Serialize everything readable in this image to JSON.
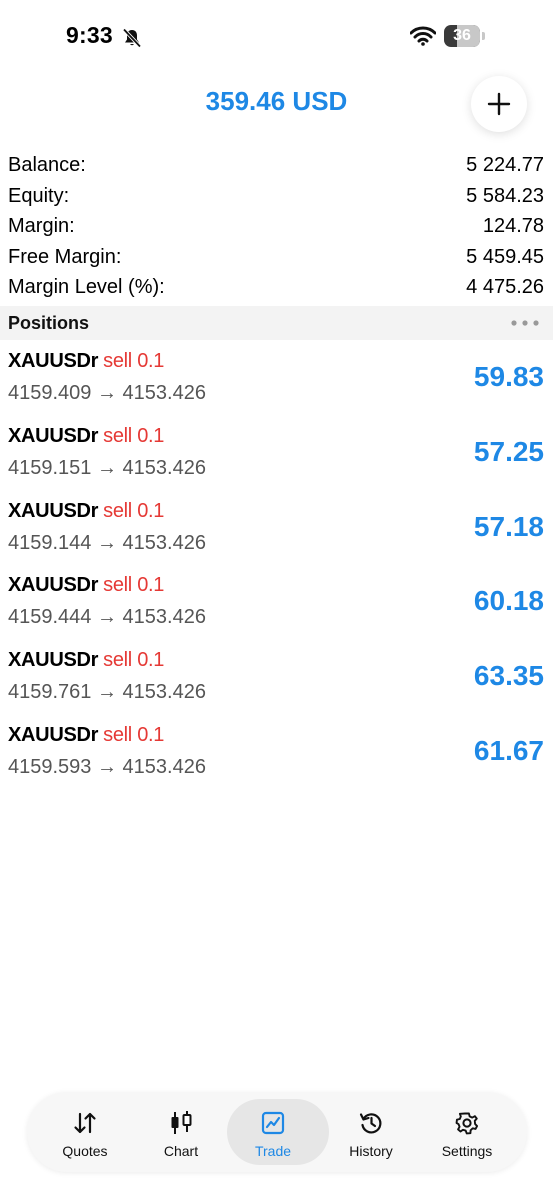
{
  "status_bar": {
    "time": "9:33",
    "battery_level": 36,
    "battery_label": "36"
  },
  "header": {
    "title": "359.46 USD",
    "add_icon": "plus-icon"
  },
  "account": [
    {
      "label": "Balance:",
      "value": "5 224.77"
    },
    {
      "label": "Equity:",
      "value": "5 584.23"
    },
    {
      "label": "Margin:",
      "value": "124.78"
    },
    {
      "label": "Free Margin:",
      "value": "5 459.45"
    },
    {
      "label": "Margin Level (%):",
      "value": "4 475.26"
    }
  ],
  "positions_section": {
    "title": "Positions",
    "menu_icon": "more-icon"
  },
  "positions": [
    {
      "symbol": "XAUUSDr",
      "type": "sell 0.1",
      "prices": "4159.409 → 4153.426",
      "profit": "59.83"
    },
    {
      "symbol": "XAUUSDr",
      "type": "sell 0.1",
      "prices": "4159.151 → 4153.426",
      "profit": "57.25"
    },
    {
      "symbol": "XAUUSDr",
      "type": "sell 0.1",
      "prices": "4159.144 → 4153.426",
      "profit": "57.18"
    },
    {
      "symbol": "XAUUSDr",
      "type": "sell 0.1",
      "prices": "4159.444 → 4153.426",
      "profit": "60.18"
    },
    {
      "symbol": "XAUUSDr",
      "type": "sell 0.1",
      "prices": "4159.761 → 4153.426",
      "profit": "63.35"
    },
    {
      "symbol": "XAUUSDr",
      "type": "sell 0.1",
      "prices": "4159.593 → 4153.426",
      "profit": "61.67"
    }
  ],
  "tabs": [
    {
      "label": "Quotes",
      "icon": "quotes-icon",
      "active": false
    },
    {
      "label": "Chart",
      "icon": "chart-icon",
      "active": false
    },
    {
      "label": "Trade",
      "icon": "trade-icon",
      "active": true
    },
    {
      "label": "History",
      "icon": "history-icon",
      "active": false
    },
    {
      "label": "Settings",
      "icon": "gear-icon",
      "active": false
    }
  ],
  "colors": {
    "accent": "#1e88e5",
    "sell": "#e53935",
    "section_bg": "#f3f3f3"
  }
}
